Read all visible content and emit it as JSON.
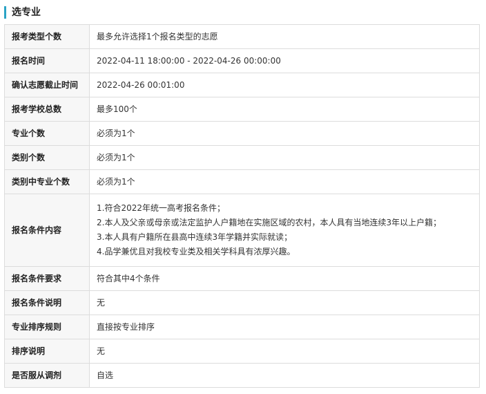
{
  "section": {
    "title": "选专业"
  },
  "rows": [
    {
      "label": "报考类型个数",
      "value": "最多允许选择1个报名类型的志愿"
    },
    {
      "label": "报名时间",
      "value": "2022-04-11 18:00:00 - 2022-04-26 00:00:00"
    },
    {
      "label": "确认志愿截止时间",
      "value": "2022-04-26 00:01:00"
    },
    {
      "label": "报考学校总数",
      "value": "最多100个"
    },
    {
      "label": "专业个数",
      "value": "必须为1个"
    },
    {
      "label": "类别个数",
      "value": "必须为1个"
    },
    {
      "label": "类别中专业个数",
      "value": "必须为1个"
    }
  ],
  "conditions": {
    "label": "报名条件内容",
    "items": [
      "1.符合2022年统一高考报名条件；",
      "2.本人及父亲或母亲或法定监护人户籍地在实施区域的农村，本人具有当地连续3年以上户籍；",
      "3.本人具有户籍所在县高中连续3年学籍并实际就读；",
      "4.品学兼优且对我校专业类及相关学科具有浓厚兴趣。"
    ]
  },
  "rows_after": [
    {
      "label": "报名条件要求",
      "value": "符合其中4个条件"
    },
    {
      "label": "报名条件说明",
      "value": "无"
    },
    {
      "label": "专业排序规则",
      "value": "直接按专业排序"
    },
    {
      "label": "排序说明",
      "value": "无"
    },
    {
      "label": "是否服从调剂",
      "value": "自选"
    }
  ]
}
